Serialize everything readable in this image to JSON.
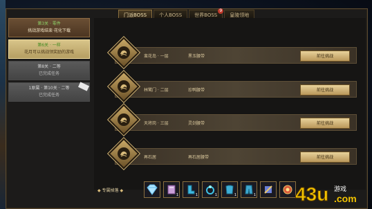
{
  "tabs": [
    {
      "label": "门派BOSS",
      "active": true
    },
    {
      "label": "个人BOSS"
    },
    {
      "label": "世界BOSS",
      "badge": "9"
    },
    {
      "label": "皇陵领地"
    }
  ],
  "sidebar": [
    {
      "line1": "第3关 · 零件",
      "line2": "挑战游戏结束·花化下载"
    },
    {
      "line1": "第6关 · 一样",
      "line2": "花月可以挑战领奖励的游戏"
    },
    {
      "line1": "第8关 · 二等",
      "line2": "已完成任务"
    },
    {
      "line1": "1原属 · 第10关 · 二等",
      "line2": "已完成任务"
    }
  ],
  "bosses": [
    {
      "name": "蛮花岛 · 一层",
      "reward": "黑玉腰带",
      "button": "前往挑战"
    },
    {
      "name": "林鹭门 · 二层",
      "reward": "珍鸭腰带",
      "button": "前往挑战"
    },
    {
      "name": "天将岗 · 三层",
      "reward": "灵剑腰带",
      "button": "前往挑战"
    },
    {
      "name": "再石居",
      "reward": "再石居腰带",
      "button": "前往挑战"
    }
  ],
  "drops": {
    "label": "专属掉落",
    "items": [
      {
        "icon": "diamond-icon",
        "qty": ""
      },
      {
        "icon": "book-icon",
        "qty": "1"
      },
      {
        "icon": "boots-icon",
        "qty": "1"
      },
      {
        "icon": "ring-icon",
        "qty": "1"
      },
      {
        "icon": "armor-icon",
        "qty": "1"
      },
      {
        "icon": "pants-icon",
        "qty": "1"
      },
      {
        "icon": "hammer-icon",
        "qty": ""
      },
      {
        "icon": "shield-icon",
        "qty": ""
      }
    ]
  },
  "watermark": {
    "text": "43u",
    "tld": ".com",
    "sub": "游戏"
  }
}
